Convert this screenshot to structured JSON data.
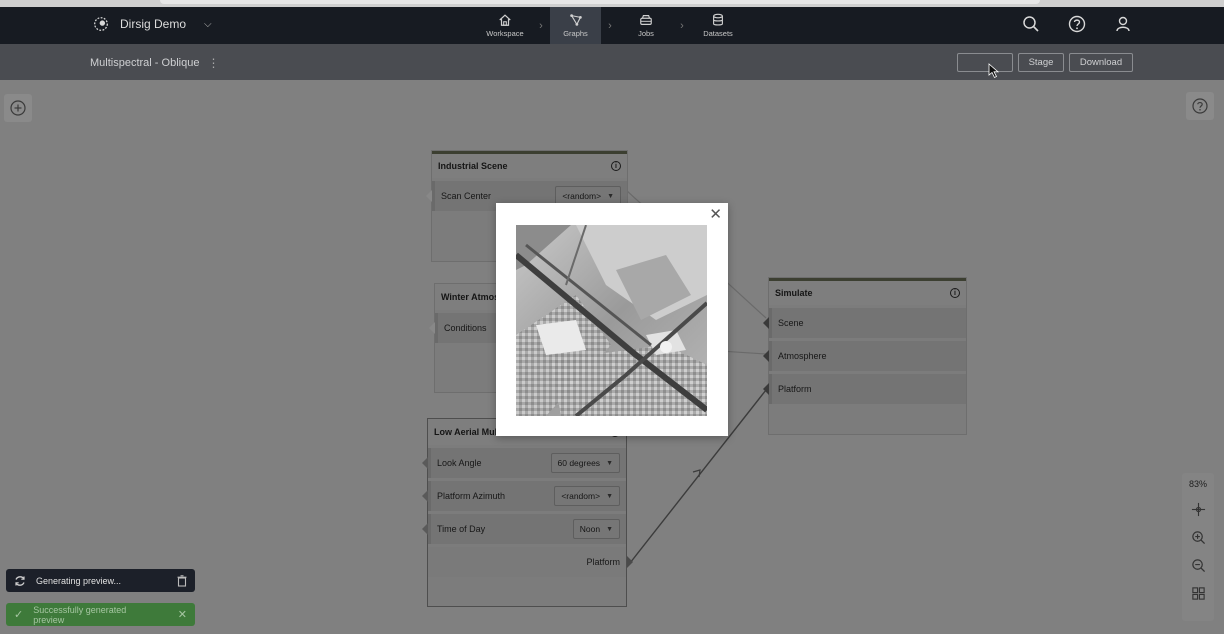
{
  "app": {
    "name": "Dirsig Demo",
    "graph_title": "Multispectral - Oblique"
  },
  "nav": {
    "items": [
      {
        "label": "Workspace",
        "icon": "home-icon",
        "active": false
      },
      {
        "label": "Graphs",
        "icon": "graph-icon",
        "active": true
      },
      {
        "label": "Jobs",
        "icon": "jobs-icon",
        "active": false
      },
      {
        "label": "Datasets",
        "icon": "database-icon",
        "active": false
      }
    ]
  },
  "toolbar": {
    "preview_label": "",
    "stage_label": "Stage",
    "download_label": "Download"
  },
  "nodes": {
    "industrial": {
      "title": "Industrial Scene",
      "rows": [
        {
          "label": "Scan Center",
          "value": "<random>"
        }
      ]
    },
    "winter": {
      "title": "Winter Atmos",
      "rows": [
        {
          "label": "Conditions"
        }
      ]
    },
    "aerial": {
      "title": "Low Aerial Multi",
      "rows": [
        {
          "label": "Look Angle",
          "value": "60 degrees"
        },
        {
          "label": "Platform Azimuth",
          "value": "<random>"
        },
        {
          "label": "Time of Day",
          "value": "Noon"
        }
      ],
      "output": "Platform"
    },
    "simulate": {
      "title": "Simulate",
      "rows": [
        {
          "label": "Scene"
        },
        {
          "label": "Atmosphere"
        },
        {
          "label": "Platform"
        }
      ]
    }
  },
  "zoom": {
    "level": "83%"
  },
  "toasts": {
    "generating": "Generating preview...",
    "success": "Successfully generated preview"
  },
  "colors": {
    "topbar": "#171b22",
    "subbar": "#4a4c51",
    "canvas": "#808080",
    "success": "#3e7a3a"
  }
}
